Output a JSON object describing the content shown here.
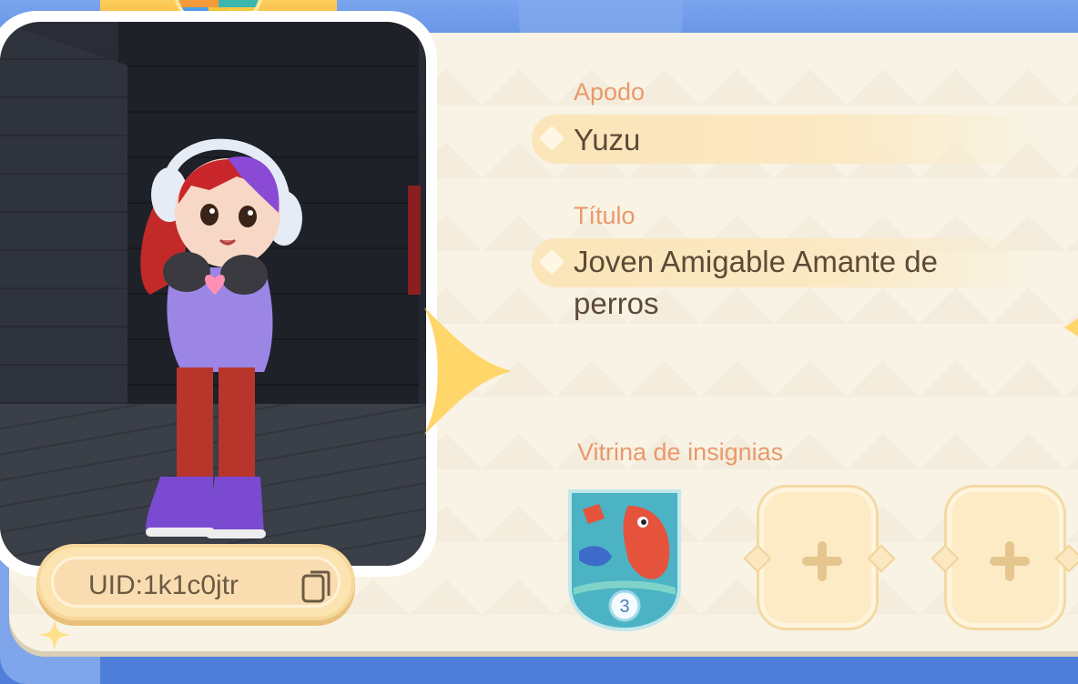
{
  "profile": {
    "uid_text": "UID:1k1c0jtr",
    "nickname_label": "Apodo",
    "nickname_value": "Yuzu",
    "title_label": "Título",
    "title_value_line1": "Joven Amigable Amante de",
    "title_value_line2": "perros",
    "badges_label": "Vitrina de insignias",
    "badges": [
      {
        "type": "fishing-badge-icon",
        "level": "3"
      },
      {
        "type": "empty-slot"
      },
      {
        "type": "empty-slot"
      }
    ]
  },
  "colors": {
    "label": "#e9996c",
    "value_text": "#5d4a36",
    "panel": "#f8f3e4",
    "accent_bar": "#fbe5b9"
  }
}
